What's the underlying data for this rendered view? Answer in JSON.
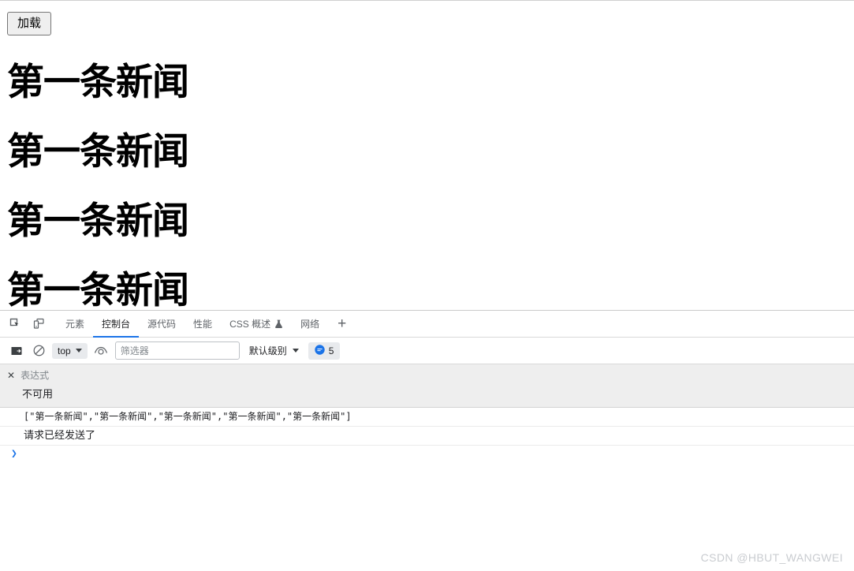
{
  "page": {
    "load_button_label": "加载",
    "news_items": [
      "第一条新闻",
      "第一条新闻",
      "第一条新闻",
      "第一条新闻"
    ]
  },
  "devtools": {
    "tabs": [
      {
        "label": "元素",
        "active": false
      },
      {
        "label": "控制台",
        "active": true
      },
      {
        "label": "源代码",
        "active": false
      },
      {
        "label": "性能",
        "active": false
      },
      {
        "label": "CSS 概述",
        "active": false,
        "has_flask": true
      },
      {
        "label": "网络",
        "active": false
      }
    ],
    "add_tab_label": "+",
    "icons": {
      "inspect": "inspect-cursor-icon",
      "device": "device-toolbar-icon",
      "sidebar": "console-sidebar-icon",
      "clear": "clear-console-icon",
      "eye": "eye-icon",
      "flask": "flask-icon"
    },
    "console_toolbar": {
      "context_value": "top",
      "filter_placeholder": "筛选器",
      "filter_value": "",
      "levels_label": "默认级别",
      "message_count": "5"
    },
    "live_expression": {
      "name": "表达式",
      "value": "不可用",
      "close_label": "✕"
    },
    "console_messages": [
      {
        "text": "[\"第一条新闻\",\"第一条新闻\",\"第一条新闻\",\"第一条新闻\",\"第一条新闻\"]",
        "mono": true
      },
      {
        "text": "请求已经发送了",
        "mono": false
      }
    ],
    "prompt_symbol": "❯"
  },
  "watermark": {
    "text": "CSDN @HBUT_WANGWEI"
  },
  "colors": {
    "accent_blue": "#1a73e8",
    "toolbar_grey": "#e8eaed",
    "live_expr_bg": "#eeeeee"
  }
}
